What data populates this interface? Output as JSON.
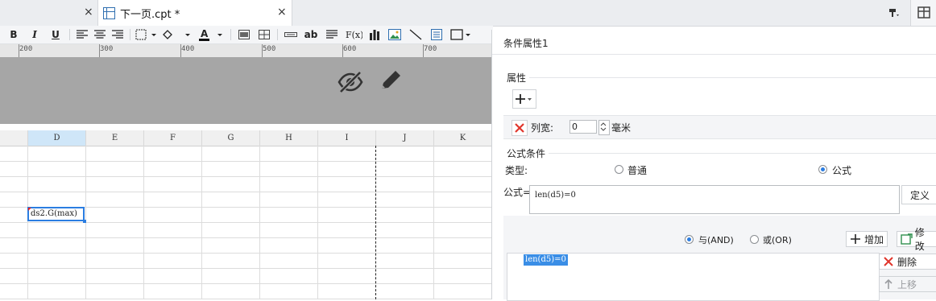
{
  "tabs": {
    "active_title": "下一页.cpt *",
    "close_glyph": "×"
  },
  "toolbar": {
    "bold": "B",
    "italic": "I",
    "underline": "U",
    "text_a": "ab"
  },
  "ruler": {
    "labels": [
      "200",
      "300",
      "400",
      "500",
      "600",
      "700"
    ]
  },
  "sheet": {
    "columns": [
      "D",
      "E",
      "F",
      "G",
      "H",
      "I",
      "J",
      "K"
    ],
    "selected_cell_value": "ds2.G(max)"
  },
  "panel": {
    "title": "条件属性1",
    "attr_section": "属性",
    "attr_row": {
      "label": "列宽:",
      "value": "0",
      "unit": "毫米"
    },
    "formula_section": "公式条件",
    "type_label": "类型:",
    "type_options": [
      "普通",
      "公式"
    ],
    "type_selected": "公式",
    "formula_label": "公式=",
    "formula_value": "len(d5)=0",
    "define_button": "定义",
    "logic_options": [
      "与(AND)",
      "或(OR)"
    ],
    "logic_selected": "与(AND)",
    "add_button": "增加",
    "modify_button": "修改",
    "delete_button": "删除",
    "move_up_button": "上移",
    "condition_list": [
      "len(d5)=0"
    ]
  },
  "colors": {
    "accent": "#2b7de1",
    "band": "#a6a6a6",
    "delete_red": "#e0352b"
  }
}
